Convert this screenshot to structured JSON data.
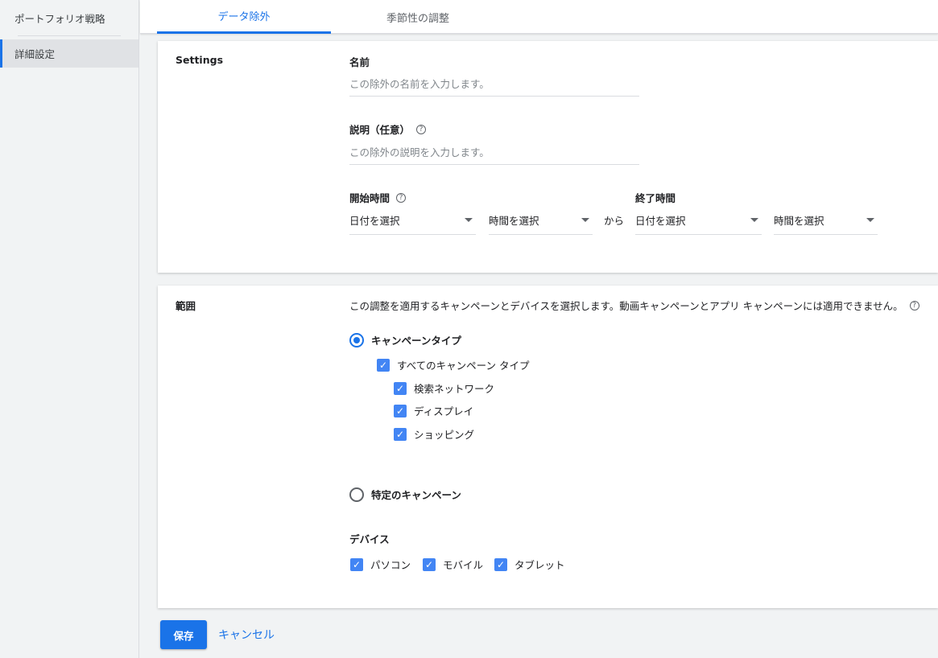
{
  "sidebar": {
    "items": [
      {
        "label": "ポートフォリオ戦略"
      },
      {
        "label": "詳細設定"
      }
    ]
  },
  "tabs": [
    {
      "label": "データ除外",
      "active": true
    },
    {
      "label": "季節性の調整",
      "active": false
    }
  ],
  "settings": {
    "section_label": "Settings",
    "name_label": "名前",
    "name_placeholder": "この除外の名前を入力します。",
    "description_label": "説明（任意）",
    "description_placeholder": "この除外の説明を入力します。",
    "start_label": "開始時間",
    "end_label": "終了時間",
    "start_date": "日付を選択",
    "start_time": "時間を選択",
    "from_label": "から",
    "end_date": "日付を選択",
    "end_time": "時間を選択"
  },
  "scope": {
    "section_label": "範囲",
    "description": "この調整を適用するキャンペーンとデバイスを選択します。動画キャンペーンとアプリ キャンペーンには適用できません。",
    "campaign_type_label": "キャンペーンタイプ",
    "campaign_type_selected": true,
    "all_campaign_types_label": "すべてのキャンペーン タイプ",
    "campaign_types": [
      {
        "label": "検索ネットワーク",
        "checked": true
      },
      {
        "label": "ディスプレイ",
        "checked": true
      },
      {
        "label": "ショッピング",
        "checked": true
      }
    ],
    "specific_campaigns_label": "特定のキャンペーン",
    "devices_label": "デバイス",
    "devices": [
      {
        "label": "パソコン",
        "checked": true
      },
      {
        "label": "モバイル",
        "checked": true
      },
      {
        "label": "タブレット",
        "checked": true
      }
    ]
  },
  "footer": {
    "save_label": "保存",
    "cancel_label": "キャンセル"
  },
  "colors": {
    "accent": "#1a73e8",
    "checkbox": "#4285f4",
    "background": "#f1f3f4"
  }
}
